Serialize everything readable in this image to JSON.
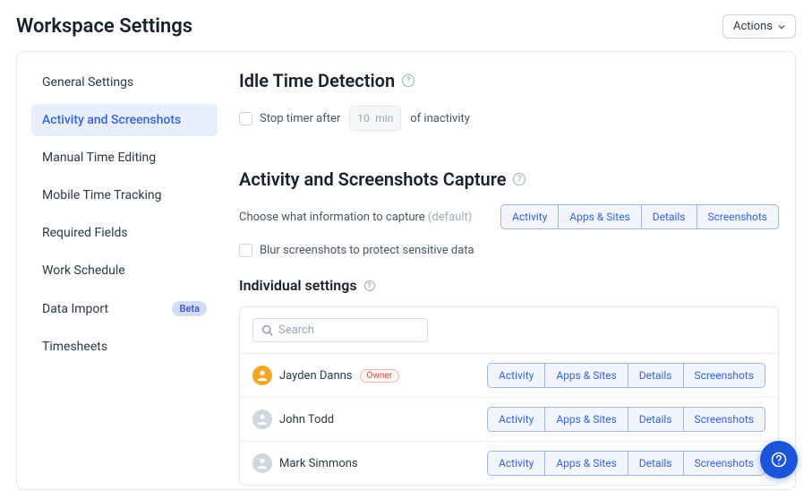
{
  "page": {
    "title": "Workspace Settings",
    "actions_label": "Actions"
  },
  "sidebar": {
    "items": [
      {
        "label": "General Settings",
        "active": false
      },
      {
        "label": "Activity and Screenshots",
        "active": true
      },
      {
        "label": "Manual Time Editing",
        "active": false
      },
      {
        "label": "Mobile Time Tracking",
        "active": false
      },
      {
        "label": "Required Fields",
        "active": false
      },
      {
        "label": "Work Schedule",
        "active": false
      },
      {
        "label": "Data Import",
        "active": false,
        "badge": "Beta"
      },
      {
        "label": "Timesheets",
        "active": false
      }
    ]
  },
  "idle": {
    "heading": "Idle Time Detection",
    "stop_label_pre": "Stop timer after",
    "value": "10",
    "unit": "min",
    "stop_label_post": "of inactivity"
  },
  "capture": {
    "heading": "Activity and Screenshots Capture",
    "choose_label": "Choose what information to capture",
    "default_label": "(default)",
    "options": [
      "Activity",
      "Apps & Sites",
      "Details",
      "Screenshots"
    ],
    "blur_label": "Blur screenshots to protect sensitive data"
  },
  "individual": {
    "heading": "Individual settings",
    "search_placeholder": "Search",
    "users": [
      {
        "name": "Jayden Danns",
        "role": "Owner",
        "avatar": "owner"
      },
      {
        "name": "John Todd",
        "role": null,
        "avatar": "gray"
      },
      {
        "name": "Mark Simmons",
        "role": null,
        "avatar": "gray"
      }
    ]
  }
}
